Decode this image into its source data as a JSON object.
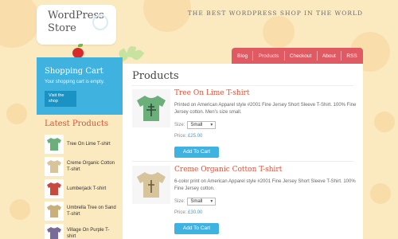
{
  "logo": {
    "text": "WordPress\nStore"
  },
  "tagline": "THE BEST WORDPRESS SHOP IN THE WORLD",
  "nav": {
    "items": [
      {
        "label": "Blog"
      },
      {
        "label": "Products",
        "active": true
      },
      {
        "label": "Checkout"
      },
      {
        "label": "About"
      },
      {
        "label": "RSS"
      }
    ]
  },
  "cart": {
    "title": "Shopping Cart",
    "empty_text": "Your shopping cart is empty.",
    "visit_label": "Visit the shop"
  },
  "latest": {
    "title": "Latest Products",
    "items": [
      {
        "label": "Tree On Lime T-shirt",
        "color": "#6bb07a"
      },
      {
        "label": "Creme Organic Cotton T-shirt",
        "color": "#d8c49a"
      },
      {
        "label": "Lumberjack T-shirt",
        "color": "#c84a3e"
      },
      {
        "label": "Umbrella Tree on Sand T-shirt",
        "color": "#c9b07a"
      },
      {
        "label": "Village On Purple T-shirt",
        "color": "#7a6a9a"
      }
    ]
  },
  "main": {
    "title": "Products",
    "products": [
      {
        "title": "Tree On Lime T-shirt",
        "description": "Printed on American Apparel style #2001 Fine Jersey Short Sleeve T-Shirt. 100% Fine Jersey cotton. Men's size small.",
        "size_label": "Size:",
        "size_value": "Small",
        "price_label": "Price:",
        "price": "£25.00",
        "button": "Add To Cart",
        "color": "#6bb07a"
      },
      {
        "title": "Creme Organic Cotton T-shirt",
        "description": "6-color print on American Apparel style #2001 Fine Jersey Short Sleeve T-Shirt. 100% Fine Jersey cotton.",
        "size_label": "Size:",
        "size_value": "Small",
        "price_label": "Price:",
        "price": "£30.00",
        "button": "Add To Cart",
        "color": "#d8c49a"
      }
    ]
  }
}
